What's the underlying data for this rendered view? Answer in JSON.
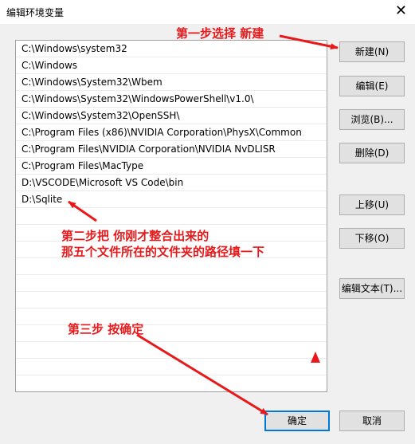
{
  "window": {
    "title": "编辑环境变量",
    "close_glyph": "✕"
  },
  "paths": [
    "C:\\Windows\\system32",
    "C:\\Windows",
    "C:\\Windows\\System32\\Wbem",
    "C:\\Windows\\System32\\WindowsPowerShell\\v1.0\\",
    "C:\\Windows\\System32\\OpenSSH\\",
    "C:\\Program Files (x86)\\NVIDIA Corporation\\PhysX\\Common",
    "C:\\Program Files\\NVIDIA Corporation\\NVIDIA NvDLISR",
    "C:\\Program Files\\MacType",
    "D:\\VSCODE\\Microsoft VS Code\\bin",
    "D:\\Sqlite"
  ],
  "buttons": {
    "new": "新建(N)",
    "edit": "编辑(E)",
    "browse": "浏览(B)...",
    "delete": "删除(D)",
    "move_up": "上移(U)",
    "move_down": "下移(O)",
    "edit_text": "编辑文本(T)...",
    "ok": "确定",
    "cancel": "取消"
  },
  "annotations": {
    "step1": "第一步选择 新建",
    "step2_line1": "第二步把 你刚才整合出来的",
    "step2_line2": "那五个文件所在的文件夹的路径填一下",
    "step3": "第三步 按确定"
  },
  "colors": {
    "annotation": "#e8191b",
    "focus_border": "#0078d7"
  }
}
